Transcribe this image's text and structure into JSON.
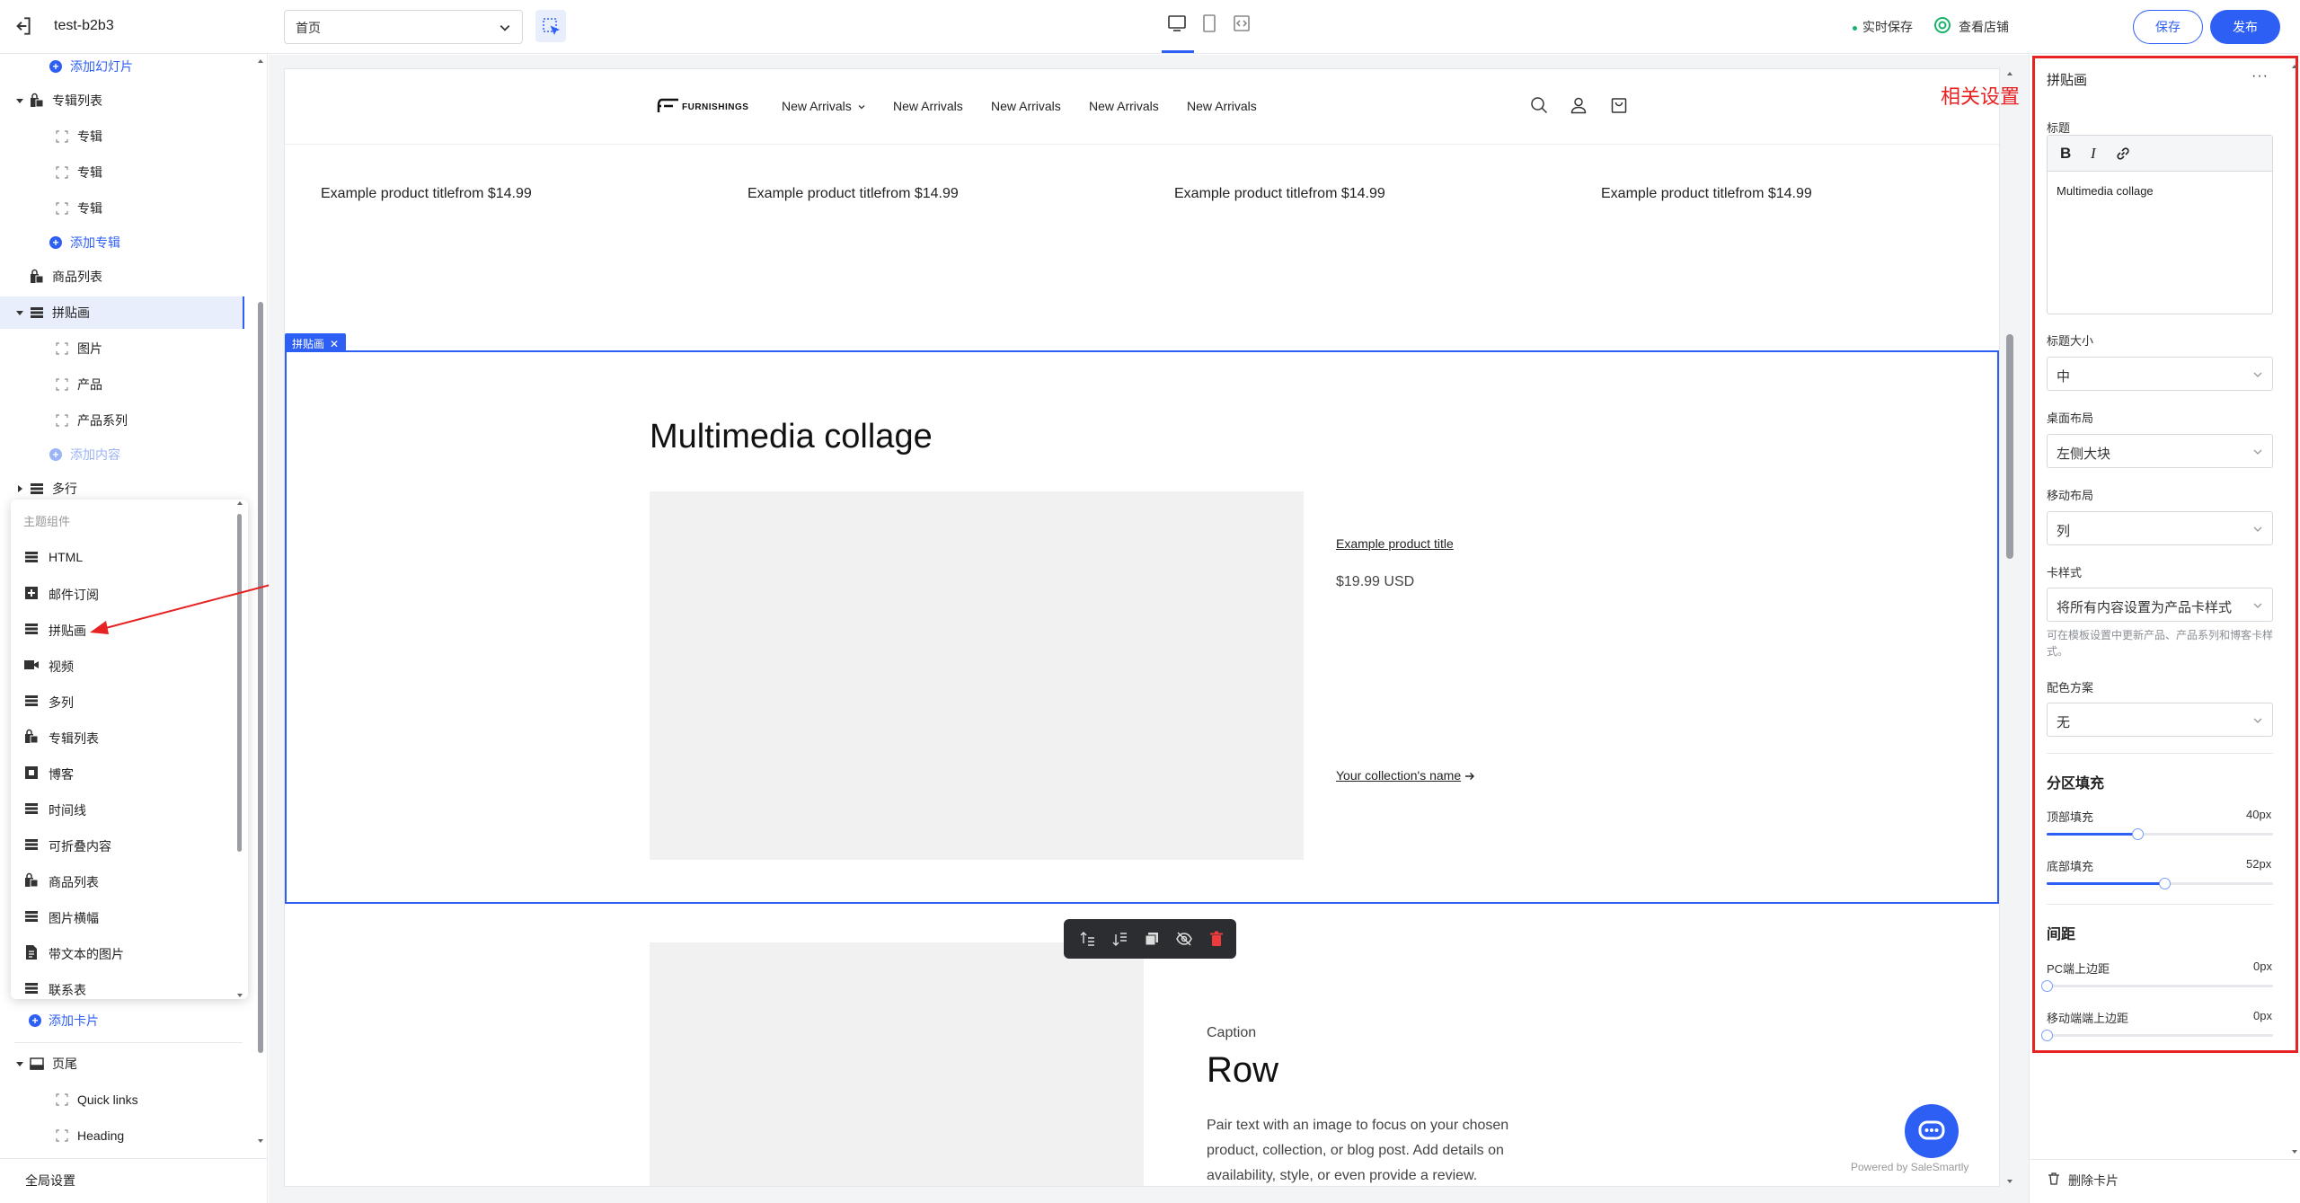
{
  "topbar": {
    "site_name": "test-b2b3",
    "page_select_value": "首页",
    "live_save": "实时保存",
    "view_store": "查看店铺",
    "save_label": "保存",
    "publish_label": "发布"
  },
  "sidebar": {
    "add_slide": "添加幻灯片",
    "collection_list": "专辑列表",
    "collection_items": [
      "专辑",
      "专辑",
      "专辑"
    ],
    "add_collection": "添加专辑",
    "product_list": "商品列表",
    "collage": "拼贴画",
    "collage_items": [
      "图片",
      "产品",
      "产品系列"
    ],
    "add_content": "添加内容",
    "multi_row": "多行",
    "add_card": "添加卡片",
    "footer": "页尾",
    "footer_items": [
      "Quick links",
      "Heading"
    ],
    "global_settings": "全局设置"
  },
  "popup": {
    "header": "主题组件",
    "items": [
      {
        "label": "HTML",
        "icon": "section-icon"
      },
      {
        "label": "邮件订阅",
        "icon": "email-plus-icon"
      },
      {
        "label": "拼贴画",
        "icon": "section-icon"
      },
      {
        "label": "视频",
        "icon": "video-icon"
      },
      {
        "label": "多列",
        "icon": "section-icon"
      },
      {
        "label": "专辑列表",
        "icon": "bag-icon"
      },
      {
        "label": "博客",
        "icon": "blog-icon"
      },
      {
        "label": "时间线",
        "icon": "section-icon"
      },
      {
        "label": "可折叠内容",
        "icon": "section-icon"
      },
      {
        "label": "商品列表",
        "icon": "bag-icon"
      },
      {
        "label": "图片横幅",
        "icon": "section-icon"
      },
      {
        "label": "带文本的图片",
        "icon": "document-icon"
      },
      {
        "label": "联系表",
        "icon": "section-icon"
      }
    ]
  },
  "preview": {
    "logo_text": "FURNISHINGS",
    "nav": [
      "New Arrivals",
      "New Arrivals",
      "New Arrivals",
      "New Arrivals",
      "New Arrivals"
    ],
    "products": [
      "Example product titlefrom $14.99",
      "Example product titlefrom $14.99",
      "Example product titlefrom $14.99",
      "Example product titlefrom $14.99"
    ],
    "selection_tag": "拼贴画",
    "collage_title": "Multimedia collage",
    "collage_product_title": "Example product title",
    "collage_price": "$19.99 USD",
    "collage_collection": "Your collection's name",
    "row_caption": "Caption",
    "row_title": "Row",
    "row_text": "Pair text with an image to focus on your chosen product, collection, or blog post. Add details on availability, style, or even provide a review.",
    "powered_by": "Powered by SaleSmartly"
  },
  "annotation": {
    "label": "相关设置",
    "color": "#e62222"
  },
  "right_panel": {
    "title": "拼贴画",
    "heading_label": "标题",
    "heading_text": "Multimedia collage",
    "heading_size_label": "标题大小",
    "heading_size_value": "中",
    "desktop_layout_label": "桌面布局",
    "desktop_layout_value": "左侧大块",
    "mobile_layout_label": "移动布局",
    "mobile_layout_value": "列",
    "card_style_label": "卡样式",
    "card_style_value": "将所有内容设置为产品卡样式",
    "card_style_hint": "可在模板设置中更新产品、产品系列和博客卡样式。",
    "color_scheme_label": "配色方案",
    "color_scheme_value": "无",
    "padding_section": "分区填充",
    "top_padding_label": "顶部填充",
    "top_padding_value": "40px",
    "top_padding_fraction": 0.4,
    "bottom_padding_label": "底部填充",
    "bottom_padding_value": "52px",
    "bottom_padding_fraction": 0.52,
    "spacing_section": "间距",
    "pc_top_margin_label": "PC端上边距",
    "pc_top_margin_value": "0px",
    "mobile_top_margin_label": "移动端端上边距",
    "mobile_top_margin_value": "0px",
    "delete_card": "删除卡片"
  },
  "colors": {
    "accent": "#2e5ff5",
    "annotation": "#e62222"
  }
}
